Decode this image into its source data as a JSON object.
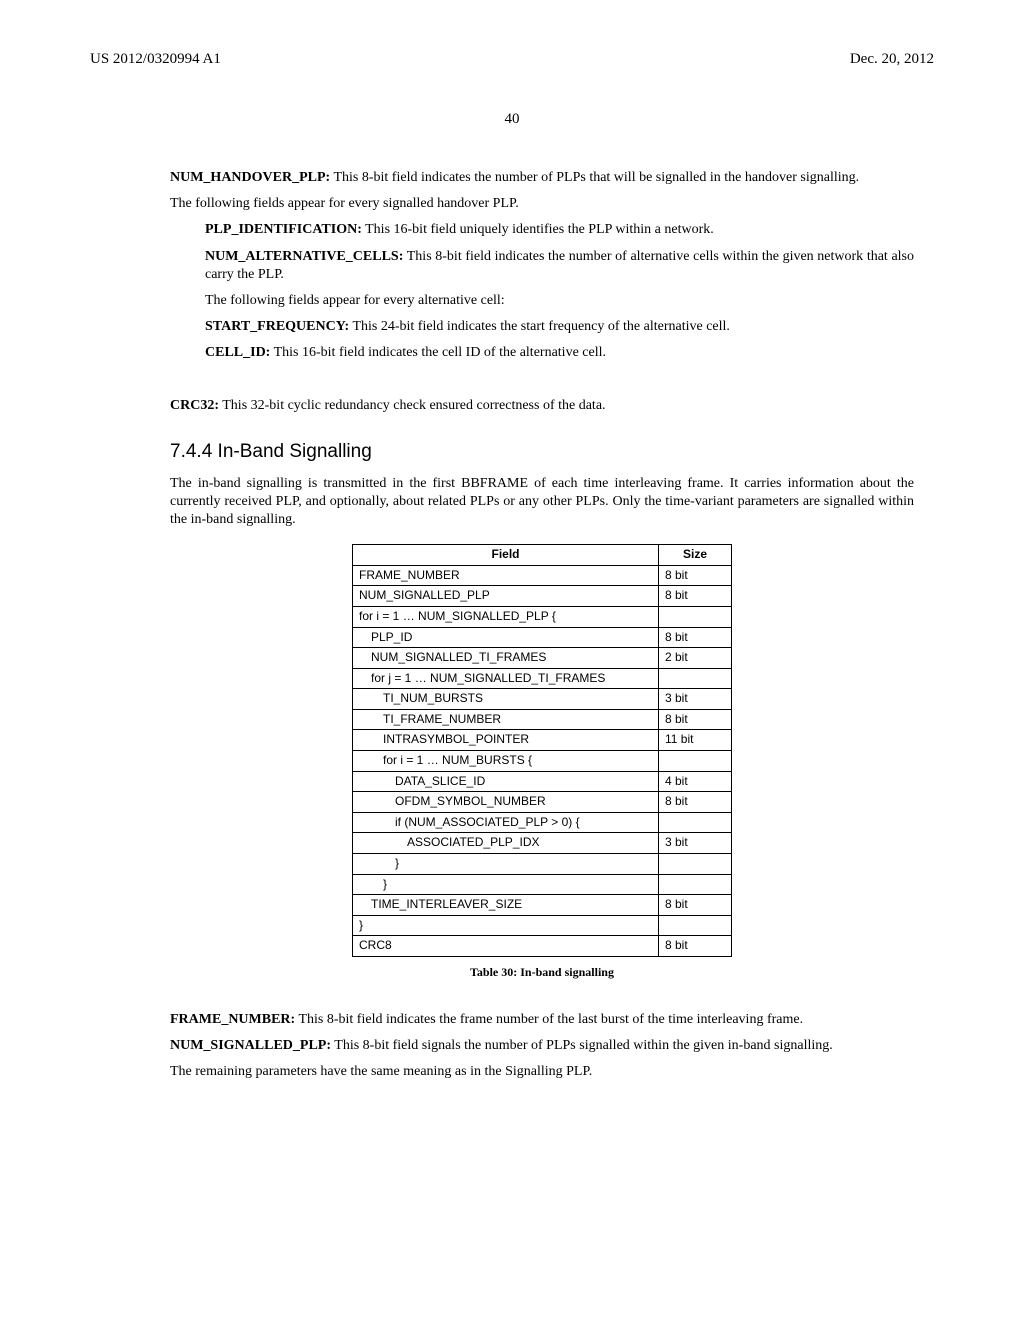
{
  "header": {
    "doc_number": "US 2012/0320994 A1",
    "date": "Dec. 20, 2012",
    "page": "40"
  },
  "defs": {
    "num_handover_plp": {
      "name": "NUM_HANDOVER_PLP:",
      "text": " This 8-bit field indicates the number of PLPs that will be signalled in the handover signalling."
    },
    "para_handover": "The following fields appear for every signalled handover PLP.",
    "plp_identification": {
      "name": "PLP_IDENTIFICATION:",
      "text": " This 16-bit field uniquely identifies the PLP within a network."
    },
    "num_alternative_cells": {
      "name": "NUM_ALTERNATIVE_CELLS:",
      "text": " This 8-bit field indicates the number of alternative cells within the given network that also carry the PLP."
    },
    "para_altcell": "The following fields appear for every alternative cell:",
    "start_frequency": {
      "name": "START_FREQUENCY:",
      "text": " This 24-bit field indicates the start frequency of the alternative cell."
    },
    "cell_id": {
      "name": "CELL_ID:",
      "text": " This 16-bit field indicates the cell ID of the alternative cell."
    },
    "crc32": {
      "name": "CRC32:",
      "text": " This 32-bit cyclic redundancy check ensured correctness of the data."
    }
  },
  "section": {
    "number": "7.4.4",
    "title": "In-Band Signalling",
    "intro": "The in-band signalling is transmitted in the first BBFRAME of each time interleaving frame. It carries information about the currently received PLP, and optionally, about related PLPs or any other PLPs. Only the time-variant parameters are signalled within the in-band signalling."
  },
  "table": {
    "header_field": "Field",
    "header_size": "Size",
    "rows": [
      {
        "field": "FRAME_NUMBER",
        "size": "8 bit",
        "indent": 0
      },
      {
        "field": "NUM_SIGNALLED_PLP",
        "size": "8 bit",
        "indent": 0
      },
      {
        "field": "for i = 1 … NUM_SIGNALLED_PLP {",
        "size": "",
        "indent": 0
      },
      {
        "field": "PLP_ID",
        "size": "8 bit",
        "indent": 1
      },
      {
        "field": "NUM_SIGNALLED_TI_FRAMES",
        "size": "2 bit",
        "indent": 1
      },
      {
        "field": "for j = 1 … NUM_SIGNALLED_TI_FRAMES",
        "size": "",
        "indent": 1
      },
      {
        "field": "TI_NUM_BURSTS",
        "size": "3 bit",
        "indent": 2
      },
      {
        "field": "TI_FRAME_NUMBER",
        "size": "8 bit",
        "indent": 2
      },
      {
        "field": "INTRASYMBOL_POINTER",
        "size": "11 bit",
        "indent": 2
      },
      {
        "field": "for i = 1 … NUM_BURSTS {",
        "size": "",
        "indent": 2
      },
      {
        "field": "DATA_SLICE_ID",
        "size": "4 bit",
        "indent": 3
      },
      {
        "field": "OFDM_SYMBOL_NUMBER",
        "size": "8 bit",
        "indent": 3
      },
      {
        "field": "if (NUM_ASSOCIATED_PLP > 0) {",
        "size": "",
        "indent": 3
      },
      {
        "field": "ASSOCIATED_PLP_IDX",
        "size": "3 bit",
        "indent": 4
      },
      {
        "field": "}",
        "size": "",
        "indent": 3
      },
      {
        "field": "}",
        "size": "",
        "indent": 2
      },
      {
        "field": "TIME_INTERLEAVER_SIZE",
        "size": "8 bit",
        "indent": 1
      },
      {
        "field": "}",
        "size": "",
        "indent": 0
      },
      {
        "field": "CRC8",
        "size": "8 bit",
        "indent": 0
      }
    ],
    "caption": "Table 30: In-band signalling"
  },
  "trailing": {
    "frame_number": {
      "name": "FRAME_NUMBER:",
      "text": " This 8-bit field indicates the frame number of the last burst of the time interleaving frame."
    },
    "num_signalled_plp": {
      "name": "NUM_SIGNALLED_PLP:",
      "text": " This 8-bit field signals the number of PLPs signalled within the given in-band signalling."
    },
    "remaining": "The remaining parameters have the same meaning as in the Signalling PLP."
  }
}
